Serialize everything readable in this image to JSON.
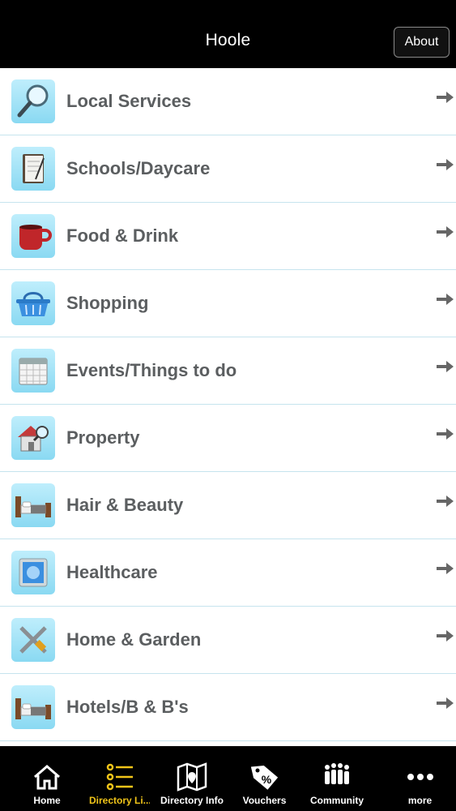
{
  "header": {
    "title": "Hoole",
    "about_label": "About"
  },
  "list": {
    "items": [
      {
        "label": "Local Services",
        "icon": "magnifier-icon"
      },
      {
        "label": "Schools/Daycare",
        "icon": "notebook-icon"
      },
      {
        "label": "Food & Drink",
        "icon": "mug-icon"
      },
      {
        "label": "Shopping",
        "icon": "basket-icon"
      },
      {
        "label": "Events/Things to do",
        "icon": "calendar-icon"
      },
      {
        "label": "Property",
        "icon": "house-icon"
      },
      {
        "label": "Hair & Beauty",
        "icon": "bed-icon"
      },
      {
        "label": "Healthcare",
        "icon": "health-icon"
      },
      {
        "label": "Home & Garden",
        "icon": "tools-icon"
      },
      {
        "label": "Hotels/B & B's",
        "icon": "bed-icon"
      }
    ]
  },
  "tabbar": {
    "tabs": [
      {
        "label": "Home",
        "icon": "home-icon"
      },
      {
        "label": "Directory Li...",
        "icon": "list-icon",
        "active": true
      },
      {
        "label": "Directory Info",
        "icon": "map-icon"
      },
      {
        "label": "Vouchers",
        "icon": "tag-icon"
      },
      {
        "label": "Community",
        "icon": "people-icon"
      },
      {
        "label": "more",
        "icon": "more-icon"
      }
    ]
  },
  "colors": {
    "accent": "#f0c419",
    "tile": "#9fe2f6",
    "divider": "#c6e4ee",
    "text": "#5b5e60"
  }
}
